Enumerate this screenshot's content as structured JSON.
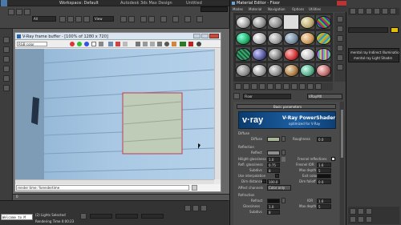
{
  "max": {
    "title": "Workspace: Default",
    "title_right": "Autodesk 3ds Max Design",
    "title_file": "Untitled",
    "quick_search_placeholder": "Type a keyword or phrase",
    "dropdown_all": "All",
    "view_dropdown": "View",
    "status_lights": "(2) Lights Selected",
    "rendering_time": "Rendering Time 0:00:23",
    "script_label": "Welcome to M",
    "timeline_frame": "0"
  },
  "vfb": {
    "title": "V-Ray frame buffer - [100% of 1280 x 720]",
    "channel": "RGB color",
    "render_time_label": "render time: %rendertime"
  },
  "mat": {
    "title": "Material Editor - Floor",
    "menu": [
      "Modes",
      "Material",
      "Navigation",
      "Options",
      "Utilities"
    ],
    "name_value": "Floor",
    "mat_type": "VRayMtl",
    "section_basic": "Basic parameters",
    "banner_brand": "v·ray",
    "banner_title": "V-Ray PowerShader",
    "banner_sub": "optimized for V-Ray",
    "diffuse_group": "Diffuse",
    "diffuse_label": "Diffuse",
    "roughness_label": "Roughness",
    "roughness_value": "0.0",
    "reflection_group": "Reflection",
    "reflect_label": "Reflect",
    "hilight_gloss_label": "Hilight glossiness",
    "hilight_gloss_value": "1.0",
    "refl_gloss_label": "Refl. glossiness",
    "refl_gloss_value": "0.75",
    "subdivs_label": "Subdivs",
    "subdivs_value": "8",
    "use_interp_label": "Use interpolation",
    "dim_distance_label": "Dim distance",
    "dim_distance_value": "100.0",
    "affect_channels_label": "Affect channels",
    "affect_channels_value": "Color only",
    "fresnel_label": "Fresnel reflections",
    "fresnel_ior_label": "Fresnel IOR",
    "fresnel_ior_value": "1.6",
    "max_depth_label": "Max depth",
    "max_depth_value": "5",
    "exit_color_label": "Exit color",
    "dim_falloff_label": "Dim falloff",
    "dim_falloff_value": "0.0",
    "refraction_group": "Refraction",
    "refract_label": "Refract",
    "ior_label": "IOR",
    "ior_value": "1.6",
    "glossiness_label": "Glossiness",
    "glossiness_value": "1.0",
    "refr_subdivs_label": "Subdivs",
    "refr_subdivs_value": "8",
    "refr_max_depth_label": "Max depth",
    "refr_max_depth_value": "5"
  },
  "right_panel": {
    "items": [
      "mental ray Indirect Illuminatio",
      "mental ray Light Shader"
    ]
  }
}
